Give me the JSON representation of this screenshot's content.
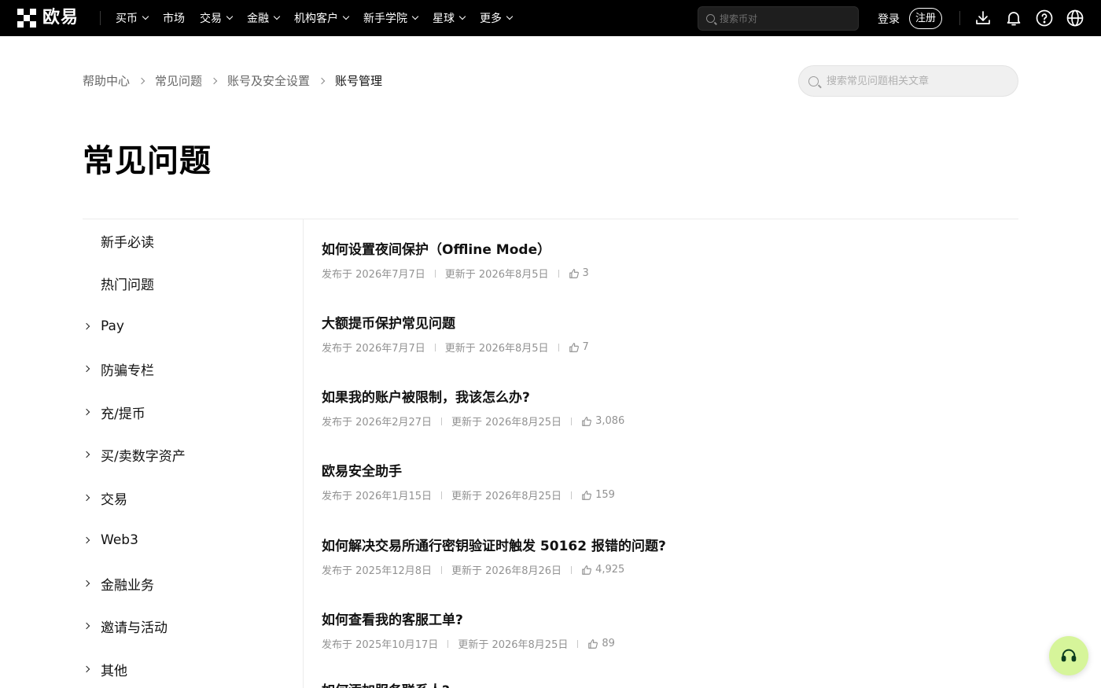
{
  "brand": {
    "name": "欧易"
  },
  "topnav": {
    "items": [
      {
        "label": "买币",
        "has_dropdown": true
      },
      {
        "label": "市场",
        "has_dropdown": false
      },
      {
        "label": "交易",
        "has_dropdown": true
      },
      {
        "label": "金融",
        "has_dropdown": true
      },
      {
        "label": "机构客户",
        "has_dropdown": true
      },
      {
        "label": "新手学院",
        "has_dropdown": true
      },
      {
        "label": "星球",
        "has_dropdown": true
      },
      {
        "label": "更多",
        "has_dropdown": true
      }
    ],
    "search_placeholder": "搜索币对",
    "login_label": "登录",
    "register_label": "注册",
    "icons": [
      "download-icon",
      "bell-icon",
      "help-icon",
      "globe-icon"
    ]
  },
  "breadcrumb": {
    "items": [
      "帮助中心",
      "常见问题",
      "账号及安全设置",
      "账号管理"
    ]
  },
  "faq_search": {
    "placeholder": "搜索常见问题相关文章"
  },
  "page_title": "常见问题",
  "sidebar": {
    "items": [
      {
        "label": "新手必读",
        "expandable": false
      },
      {
        "label": "热门问题",
        "expandable": false
      },
      {
        "label": "Pay",
        "expandable": true
      },
      {
        "label": "防骗专栏",
        "expandable": true
      },
      {
        "label": "充/提币",
        "expandable": true
      },
      {
        "label": "买/卖数字资产",
        "expandable": true
      },
      {
        "label": "交易",
        "expandable": true
      },
      {
        "label": "Web3",
        "expandable": true
      },
      {
        "label": "金融业务",
        "expandable": true
      },
      {
        "label": "邀请与活动",
        "expandable": true
      },
      {
        "label": "其他",
        "expandable": true
      }
    ]
  },
  "articles": [
    {
      "title": "如何设置夜间保护（Offline Mode）",
      "published": "发布于 2026年7月7日",
      "updated": "更新于 2026年8月5日",
      "likes": "3"
    },
    {
      "title": "大额提币保护常见问题",
      "published": "发布于 2026年7月7日",
      "updated": "更新于 2026年8月5日",
      "likes": "7"
    },
    {
      "title": "如果我的账户被限制，我该怎么办?",
      "published": "发布于 2026年2月27日",
      "updated": "更新于 2026年8月25日",
      "likes": "3,086"
    },
    {
      "title": "欧易安全助手",
      "published": "发布于 2026年1月15日",
      "updated": "更新于 2026年8月25日",
      "likes": "159"
    },
    {
      "title": "如何解决交易所通行密钥验证时触发 50162 报错的问题?",
      "published": "发布于 2025年12月8日",
      "updated": "更新于 2026年8月26日",
      "likes": "4,925"
    },
    {
      "title": "如何查看我的客服工单?",
      "published": "发布于 2025年10月17日",
      "updated": "更新于 2026年8月25日",
      "likes": "89"
    },
    {
      "title": "如何添加服务联系人?",
      "published": "",
      "updated": "",
      "likes": ""
    }
  ],
  "colors": {
    "nav_bg": "#000000",
    "accent": "#d6f59a",
    "meta_text": "#929292"
  }
}
